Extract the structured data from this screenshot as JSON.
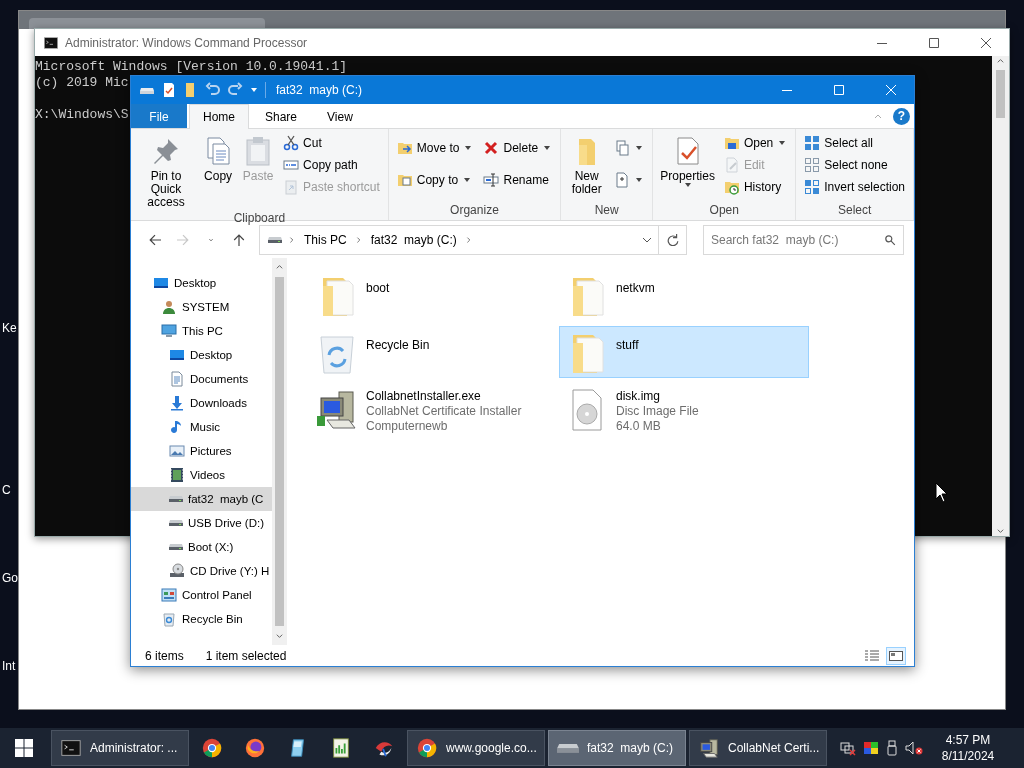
{
  "desktop": {
    "icon_labels": [
      "Ke",
      "C",
      "Go",
      "Int"
    ]
  },
  "cmd_window": {
    "title": "Administrator: Windows Command Processor",
    "blocks": [
      [
        "Microsoft Windows [Version 10.0.19041.1]",
        "(c) 2019 Mic"
      ],
      [
        "X:\\Windows\\S"
      ]
    ]
  },
  "explorer": {
    "title": "fat32  mayb (C:)",
    "tabs": [
      {
        "kind": "file",
        "label": "File",
        "selected": false
      },
      {
        "kind": "tab",
        "label": "Home",
        "selected": true
      },
      {
        "kind": "tab",
        "label": "Share",
        "selected": false
      },
      {
        "kind": "tab",
        "label": "View",
        "selected": false
      }
    ],
    "help_label": "?",
    "ribbon": {
      "groups": [
        {
          "label": "Clipboard",
          "items": [
            {
              "kind": "pin",
              "label": "Pin to Quick access",
              "dropdown": false,
              "disabled": false
            },
            {
              "kind": "copy",
              "label": "Copy",
              "dropdown": false,
              "disabled": false
            },
            {
              "kind": "paste",
              "label": "Paste",
              "dropdown": false,
              "disabled": true
            },
            {
              "stack": [
                {
                  "kind": "cut",
                  "label": "Cut",
                  "dropdown": false,
                  "disabled": false
                },
                {
                  "kind": "copy-path",
                  "label": "Copy path",
                  "dropdown": false,
                  "disabled": false
                },
                {
                  "kind": "paste-shortcut",
                  "label": "Paste shortcut",
                  "dropdown": false,
                  "disabled": true
                }
              ]
            }
          ]
        },
        {
          "label": "Organize",
          "items": [
            {
              "stack": [
                {
                  "kind": "move-to",
                  "label": "Move to",
                  "dropdown": true,
                  "disabled": false
                },
                {
                  "kind": "copy-to",
                  "label": "Copy to",
                  "dropdown": true,
                  "disabled": false
                }
              ]
            },
            {
              "stack": [
                {
                  "kind": "delete",
                  "label": "Delete",
                  "dropdown": true,
                  "disabled": false
                },
                {
                  "kind": "rename",
                  "label": "Rename",
                  "dropdown": false,
                  "disabled": false
                }
              ]
            }
          ]
        },
        {
          "label": "New",
          "items": [
            {
              "kind": "new-folder",
              "label": "New folder",
              "dropdown": false,
              "disabled": false
            },
            {
              "stack": [
                {
                  "kind": "new-item",
                  "dropdown": true,
                  "disabled": false
                },
                {
                  "kind": "easy-access",
                  "dropdown": true,
                  "disabled": false
                }
              ]
            }
          ]
        },
        {
          "label": "Open",
          "items": [
            {
              "kind": "properties",
              "label": "Properties",
              "dropdown": true,
              "disabled": false
            },
            {
              "stack": [
                {
                  "kind": "open",
                  "label": "Open",
                  "dropdown": true,
                  "disabled": false
                },
                {
                  "kind": "edit",
                  "label": "Edit",
                  "dropdown": false,
                  "disabled": true
                },
                {
                  "kind": "history",
                  "label": "History",
                  "dropdown": false,
                  "disabled": false
                }
              ]
            }
          ]
        },
        {
          "label": "Select",
          "items": [
            {
              "stack": [
                {
                  "kind": "select-all",
                  "label": "Select all",
                  "dropdown": false,
                  "disabled": false
                },
                {
                  "kind": "select-none",
                  "label": "Select none",
                  "dropdown": false,
                  "disabled": false
                },
                {
                  "kind": "invert",
                  "label": "Invert selection",
                  "dropdown": false,
                  "disabled": false
                }
              ]
            }
          ]
        }
      ]
    },
    "nav": {
      "buttons": [
        {
          "kind": "back",
          "disabled": false
        },
        {
          "kind": "forward",
          "disabled": true
        },
        {
          "kind": "recent",
          "disabled": false
        },
        {
          "kind": "up",
          "disabled": false
        }
      ],
      "crumbs": [
        "This PC",
        "fat32  mayb (C:)"
      ],
      "search": {
        "placeholder": "Search fat32  mayb (C:)"
      }
    },
    "sidebar": {
      "items": [
        {
          "kind": "desktop",
          "label": "Desktop",
          "selected": false,
          "children": [
            {
              "kind": "user",
              "label": "SYSTEM",
              "selected": false
            },
            {
              "kind": "pc",
              "label": "This PC",
              "selected": false,
              "children": [
                {
                  "kind": "desktop",
                  "label": "Desktop",
                  "selected": false
                },
                {
                  "kind": "documents",
                  "label": "Documents",
                  "selected": false
                },
                {
                  "kind": "downloads",
                  "label": "Downloads",
                  "selected": false
                },
                {
                  "kind": "music",
                  "label": "Music",
                  "selected": false
                },
                {
                  "kind": "pictures",
                  "label": "Pictures",
                  "selected": false
                },
                {
                  "kind": "videos",
                  "label": "Videos",
                  "selected": false
                },
                {
                  "kind": "drive",
                  "label": "fat32  mayb (C",
                  "selected": true
                },
                {
                  "kind": "drive",
                  "label": "USB Drive (D:)",
                  "selected": false
                },
                {
                  "kind": "drive",
                  "label": "Boot (X:)",
                  "selected": false
                },
                {
                  "kind": "cd",
                  "label": "CD Drive (Y:) H",
                  "selected": false
                }
              ]
            },
            {
              "kind": "control-panel",
              "label": "Control Panel",
              "selected": false
            },
            {
              "kind": "recycle",
              "label": "Recycle Bin",
              "selected": false
            }
          ]
        }
      ]
    },
    "files": [
      {
        "kind": "folder",
        "name": "boot",
        "selected": false
      },
      {
        "kind": "folder",
        "name": "netkvm",
        "selected": false
      },
      {
        "kind": "recycle",
        "name": "Recycle Bin",
        "selected": false
      },
      {
        "kind": "folder",
        "name": "stuff",
        "selected": true
      },
      {
        "kind": "installer",
        "name": "CollabnetInstaller.exe",
        "details": [
          "CollabNet Certificate Installer",
          "Computernewb"
        ],
        "selected": false
      },
      {
        "kind": "disc",
        "name": "disk.img",
        "details": [
          "Disc Image File",
          "64.0 MB"
        ],
        "selected": false
      }
    ],
    "status": {
      "item_count": "6 items",
      "selection": "1 item selected",
      "views": [
        {
          "kind": "details",
          "selected": false
        },
        {
          "kind": "tiles",
          "selected": true
        }
      ]
    }
  },
  "taskbar": {
    "buttons": [
      {
        "kind": "cmd",
        "label": "Administrator: ...",
        "selected": false
      },
      {
        "kind": "chrome",
        "selected": false
      },
      {
        "kind": "firefox",
        "selected": false
      },
      {
        "kind": "tablet",
        "selected": false
      },
      {
        "kind": "chart",
        "selected": false
      },
      {
        "kind": "swirl",
        "selected": false
      },
      {
        "kind": "chrome",
        "label": "www.google.co...",
        "selected": false
      },
      {
        "kind": "drive",
        "label": "fat32  mayb (C:)",
        "selected": true
      },
      {
        "kind": "installer",
        "label": "CollabNet Certi...",
        "selected": false
      }
    ],
    "clock": {
      "time": "4:57 PM",
      "date": "8/11/2024"
    }
  }
}
